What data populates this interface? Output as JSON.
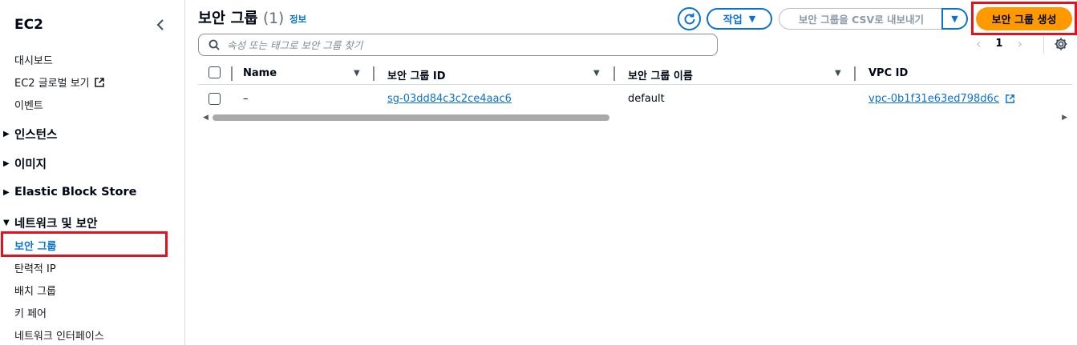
{
  "sidebar": {
    "title": "EC2",
    "links": [
      {
        "label": "대시보드"
      },
      {
        "label": "EC2 글로벌 보기",
        "external": true
      },
      {
        "label": "이벤트"
      }
    ],
    "sections": [
      {
        "label": "인스턴스",
        "expanded": false
      },
      {
        "label": "이미지",
        "expanded": false
      },
      {
        "label": "Elastic Block Store",
        "expanded": false
      },
      {
        "label": "네트워크 및 보안",
        "expanded": true
      }
    ],
    "network_items": [
      {
        "label": "보안 그룹",
        "active": true
      },
      {
        "label": "탄력적 IP"
      },
      {
        "label": "배치 그룹"
      },
      {
        "label": "키 페어"
      },
      {
        "label": "네트워크 인터페이스"
      }
    ]
  },
  "header": {
    "title": "보안 그룹",
    "count": "(1)",
    "info": "정보",
    "actions_label": "작업",
    "export_label": "보안 그룹을 CSV로 내보내기",
    "create_label": "보안 그룹 생성"
  },
  "search": {
    "placeholder": "속성 또는 태그로 보안 그룹 찾기"
  },
  "pagination": {
    "current_page": "1"
  },
  "table": {
    "columns": [
      "Name",
      "보안 그룹 ID",
      "보안 그룹 이름",
      "VPC ID"
    ],
    "rows": [
      {
        "name": "–",
        "group_id": "sg-03dd84c3c2ce4aac6",
        "group_name": "default",
        "vpc_id": "vpc-0b1f31e63ed798d6c"
      }
    ]
  },
  "colors": {
    "link": "#0972d3",
    "primary_button": "#ff9900",
    "highlight": "#e0141e"
  }
}
